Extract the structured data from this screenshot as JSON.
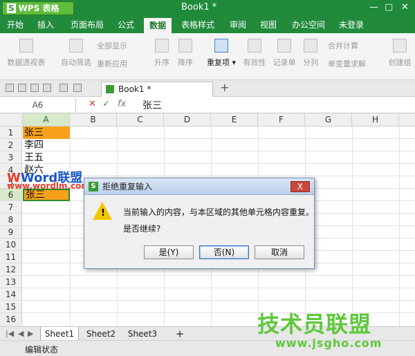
{
  "app": {
    "name": "WPS 表格",
    "logo_letter": "S",
    "doc_title": "Book1 *"
  },
  "menu_tabs": [
    "开始",
    "插入",
    "页面布局",
    "公式",
    "数据",
    "表格样式",
    "审阅",
    "视图",
    "办公空间",
    "未登录"
  ],
  "active_tab": "数据",
  "ribbon": {
    "pivot": "数据透视表",
    "autofilter": "自动筛选",
    "show_all": "全部显示",
    "reapply": "重新应用",
    "sort_asc": "升序",
    "sort_desc": "降序",
    "duplicates": "重复项",
    "validity": "有效性",
    "record": "记录单",
    "split": "分列",
    "merge_calc": "合并计算",
    "single_var": "单变量求解",
    "create_group": "创建组"
  },
  "doc_tab": {
    "label": "Book1 *"
  },
  "formula_bar": {
    "name_box": "A6",
    "fx": "fx",
    "value": "张三"
  },
  "grid": {
    "columns": [
      "A",
      "B",
      "C",
      "D",
      "E",
      "F",
      "G",
      "H"
    ],
    "rows": [
      "1",
      "2",
      "3",
      "4",
      "5",
      "6",
      "7",
      "8",
      "9",
      "10",
      "11",
      "12",
      "13",
      "14",
      "15",
      "16"
    ],
    "cells": {
      "A1": "张三",
      "A2": "李四",
      "A3": "王五",
      "A4": "赵六",
      "A6": "张三"
    },
    "highlight_color": "#f7a11a"
  },
  "watermarks": {
    "top": "Word联盟",
    "top_url": "www.wordlm.com",
    "bottom": "技术员联盟",
    "bottom_url": "www.jsgho.com"
  },
  "dialog": {
    "title": "拒绝重复输入",
    "message_line1": "当前输入的内容，与本区域的其他单元格内容重复。",
    "message_line2": "是否继续?",
    "buttons": {
      "yes": "是(Y)",
      "no": "否(N)",
      "cancel": "取消"
    },
    "close": "X"
  },
  "sheets": [
    "Sheet1",
    "Sheet2",
    "Sheet3"
  ],
  "active_sheet": "Sheet1",
  "status_text": "编辑状态"
}
